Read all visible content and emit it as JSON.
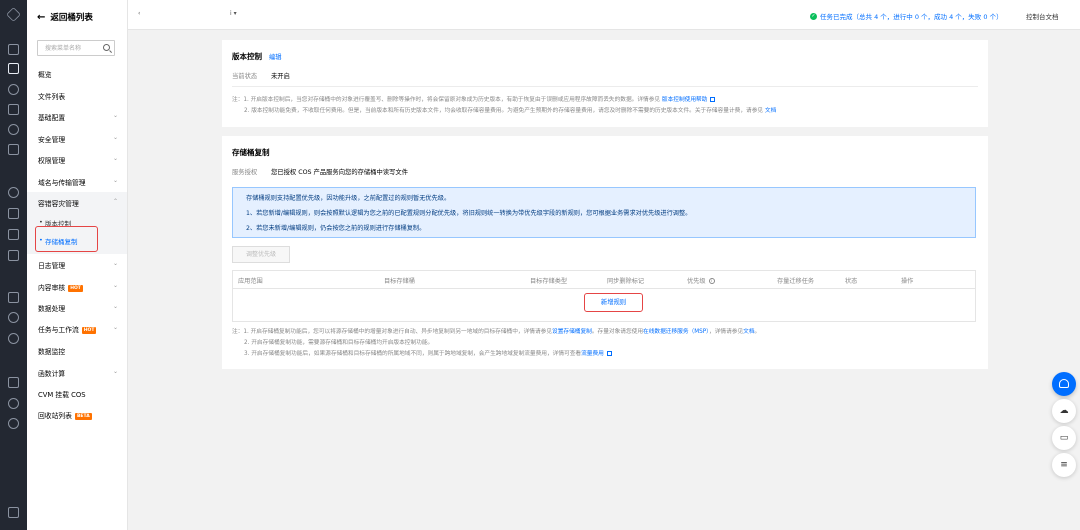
{
  "sidebar": {
    "back_label": "返回桶列表",
    "search_placeholder": "搜索菜单名称",
    "items": [
      {
        "label": "概览"
      },
      {
        "label": "文件列表"
      },
      {
        "label": "基础配置"
      },
      {
        "label": "安全管理"
      },
      {
        "label": "权限管理"
      },
      {
        "label": "域名与传输管理"
      },
      {
        "label": "容错容灾管理"
      },
      {
        "label": "日志管理"
      },
      {
        "label": "内容审核",
        "badge": "HOT"
      },
      {
        "label": "数据处理"
      },
      {
        "label": "任务与工作流",
        "badge": "HOT"
      },
      {
        "label": "数据监控"
      },
      {
        "label": "函数计算"
      },
      {
        "label": "CVM 挂载 COS"
      },
      {
        "label": "回收站列表",
        "badge": "BETA"
      }
    ],
    "subitems": [
      {
        "label": "版本控制"
      },
      {
        "label": "存储桶复制"
      }
    ]
  },
  "topbar": {
    "crumb_a": "‹",
    "crumb_b": "i ▾",
    "task_status": "任务已完成（总共 4 个，进行中 0 个，成功 4 个，失败 0 个）",
    "console_doc": "控制台文档"
  },
  "version_control": {
    "title": "版本控制",
    "edit": "编辑",
    "status_label": "当前状态",
    "status_value": "未开启",
    "note1": "注：1. 开启版本控制后，当您对存储桶中的对象进行覆盖写、删除等操作时，将会保留原对象成为历史版本，有助于恢复由于误删或应用程序故障而丢失的数据。详情参见",
    "note1_link": "版本控制使用帮助",
    "note2": "2. 版本控制功能免费，不收取任何费用。但是，当前版本和所有历史版本文件，均会收取存储容量费用。为避免产生预期外的存储容量费用，请您及时删除不需要的历史版本文件。关于存储容量计费，请参见",
    "note2_link": "文档"
  },
  "replication": {
    "title": "存储桶复制",
    "auth_label": "服务授权",
    "auth_value": "您已授权 COS 产品服务向您的存储桶中读写文件",
    "info_lines": [
      "存储桶规则支持配置优先级，因功能升级，之前配置过的规则暂无优先级。",
      "1、若您新增/编辑规则，则会按照默认逻辑为您之前的已配置规则分配优先级，将旧规则统一转换为带优先级字段的新规则，您可根据业务需求对优先级进行调整。",
      "2、若您未新增/编辑规则，仍会按您之前的规则进行存储桶复制。"
    ],
    "priority_button": "调整优先级",
    "columns": [
      "应用范围",
      "目标存储桶",
      "目标存储类型",
      "同步删除标记",
      "优先级",
      "存量迁移任务",
      "状态",
      "操作"
    ],
    "new_rule": "新增规则",
    "note1": "注：1. 开启存储桶复制功能后，您可以将源存储桶中的增量对象进行自动、异步地复制到另一地域的目标存储桶中，详情请参见",
    "note1_link": "设置存储桶复制",
    "note1_mid": "。存量对象请您使用",
    "note1_link2": "在线数据迁移服务（MSP）",
    "note1_tail": "，详情请参见",
    "note1_link3": "文档",
    "note1_end": "。",
    "note2": "2. 开启存储桶复制功能，需要源存储桶和目标存储桶均开启版本控制功能。",
    "note3": "3. 开启存储桶复制功能后，如果源存储桶和目标存储桶的所属地域不同，则属于跨地域复制，会产生跨地域复制流量费用，详情可查看",
    "note3_link": "流量费用"
  },
  "colors": {
    "accent": "#006eff",
    "highlight": "#e54545",
    "success": "#0abf5b",
    "hot_badge": "#ff7200"
  },
  "icons": [
    "dashboard-icon",
    "cos-icon",
    "link-icon",
    "grid-icon",
    "chart-icon",
    "list-icon",
    "globe-icon",
    "network-icon",
    "table-icon",
    "box-icon",
    "doc-icon",
    "search-icon",
    "settings-icon"
  ]
}
